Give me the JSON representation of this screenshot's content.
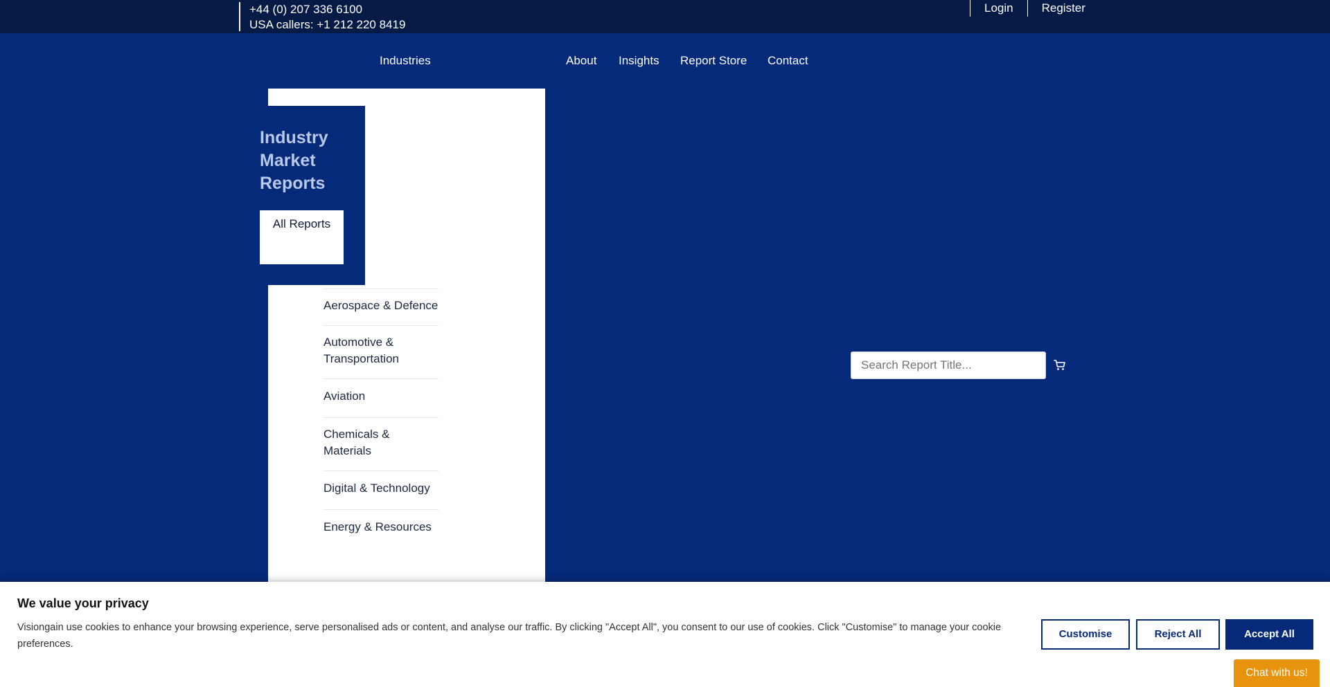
{
  "topbar": {
    "phone_uk": "+44 (0) 207 336 6100",
    "phone_usa": "USA callers: +1 212 220 8419",
    "login": "Login",
    "register": "Register"
  },
  "nav": {
    "industries": "Industries",
    "about": "About",
    "insights": "Insights",
    "report_store": "Report Store",
    "contact": "Contact"
  },
  "mega_menu": {
    "title": "Industry Market Reports",
    "all_reports": "All Reports",
    "categories": [
      "Aerospace & Defence",
      "Automotive & Transportation",
      "Aviation",
      "Chemicals & Materials",
      "Digital & Technology",
      "Energy & Resources"
    ]
  },
  "search": {
    "placeholder": "Search Report Title..."
  },
  "cart": {
    "icon": "cart-icon"
  },
  "cookie": {
    "title": "We value your privacy",
    "text": "Visiongain use cookies to enhance your browsing experience, serve personalised ads or content, and analyse our traffic. By clicking \"Accept All\", you consent to our use of cookies. Click \"Customise\" to manage your cookie preferences.",
    "customise": "Customise",
    "reject_all": "Reject All",
    "accept_all": "Accept All"
  },
  "chat": {
    "label": "Chat with us!"
  },
  "colors": {
    "brand_navy": "#062a7a",
    "topbar": "#051a45",
    "chat_orange": "#e8930d"
  }
}
